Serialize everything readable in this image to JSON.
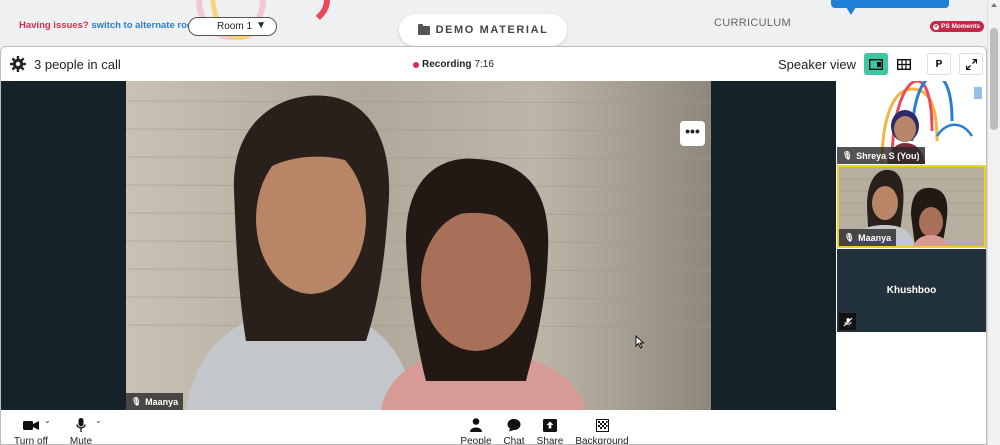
{
  "colors": {
    "accent": "#3ec7a0",
    "recording": "#e0245e",
    "issues_red": "#d62d4f",
    "link_blue": "#2a7fd4",
    "badge": "#c6264a"
  },
  "topbar": {
    "issues_text": "Having issues?",
    "switch_link": "switch to alternate room",
    "room_value": "Room 1",
    "demo_button": "DEMO MATERIAL",
    "curriculum_link": "CURRICULUM",
    "ps_badge": "PS Moments"
  },
  "call": {
    "people_count": "3 people in call",
    "recording_label": "Recording",
    "recording_time": "7:16",
    "speaker_view": "Speaker view",
    "p_button": "P",
    "more_button": "•••"
  },
  "main_video": {
    "name": "Maanya"
  },
  "participants": [
    {
      "name": "Shreya S (You)"
    },
    {
      "name": "Maanya"
    },
    {
      "name": "Khushboo"
    }
  ],
  "controls": {
    "camera": "Turn off",
    "mute": "Mute",
    "people": "People",
    "chat": "Chat",
    "share": "Share",
    "background": "Background"
  }
}
